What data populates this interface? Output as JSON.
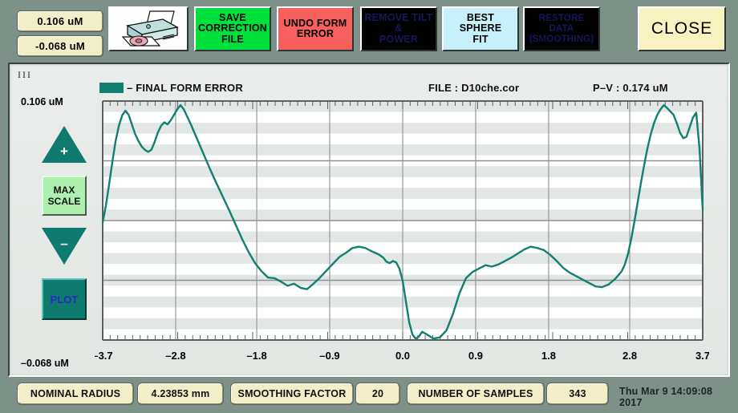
{
  "toolbar": {
    "readout_max": "0.106 uM",
    "readout_min": "-0.068 uM",
    "print_icon": "printer-icon",
    "save_label": "SAVE\nCORRECTION\nFILE",
    "undo_label": "UNDO FORM\nERROR",
    "remove_label": "REMOVE TILT &\nPOWER",
    "sphere_label": "BEST\nSPHERE\nFIT",
    "restore_label": "RESTORE\nDATA\n(SMOOTHING)",
    "close_label": "CLOSE"
  },
  "panel": {
    "corner_mark": "III",
    "legend_label": "– FINAL FORM ERROR",
    "legend_color": "#127f71",
    "file_info": "FILE :  D10che.cor",
    "pv_info": "P–V :   0.174 uM",
    "y_top": "0.106 uM",
    "y_bottom": "–0.068 uM",
    "ctl_max_scale": "MAX\nSCALE",
    "ctl_plot": "PLOT",
    "ctl_up_sign": "+",
    "ctl_down_sign": "–"
  },
  "status": {
    "nominal_radius_label": "NOMINAL RADIUS",
    "nominal_radius_value": "4.23853 mm",
    "smoothing_label": "SMOOTHING FACTOR",
    "smoothing_value": "20",
    "samples_label": "NUMBER OF SAMPLES",
    "samples_value": "343",
    "timestamp": "Thu Mar  9 14:09:08 2017"
  },
  "chart_data": {
    "type": "line",
    "title": "FINAL FORM ERROR",
    "xlabel": "",
    "ylabel": "uM",
    "xlim": [
      -3.7,
      3.7
    ],
    "ylim": [
      -0.068,
      0.106
    ],
    "grid": true,
    "legend_position": "top-left",
    "xticks": [
      -3.7,
      -2.8,
      -1.8,
      -0.9,
      0.0,
      0.9,
      1.8,
      2.8,
      3.7
    ],
    "xticklabels": [
      "–3.7",
      "–2.8",
      "–1.8",
      "–0.9",
      "0.0",
      "0.9",
      "1.8",
      "2.8",
      "3.7"
    ],
    "yticks": [
      -0.068,
      0.106
    ],
    "yticklabels": [
      "–0.068 uM",
      "0.106 uM"
    ],
    "series": [
      {
        "name": "FINAL FORM ERROR",
        "color": "#127f71",
        "x": [
          -3.7,
          -3.66,
          -3.62,
          -3.58,
          -3.54,
          -3.5,
          -3.46,
          -3.42,
          -3.38,
          -3.34,
          -3.3,
          -3.26,
          -3.22,
          -3.18,
          -3.14,
          -3.1,
          -3.06,
          -3.02,
          -2.98,
          -2.94,
          -2.9,
          -2.86,
          -2.82,
          -2.78,
          -2.74,
          -2.7,
          -2.62,
          -2.54,
          -2.46,
          -2.38,
          -2.3,
          -2.22,
          -2.14,
          -2.06,
          -1.98,
          -1.9,
          -1.82,
          -1.74,
          -1.66,
          -1.58,
          -1.5,
          -1.42,
          -1.34,
          -1.26,
          -1.18,
          -1.1,
          -1.02,
          -0.94,
          -0.86,
          -0.78,
          -0.7,
          -0.62,
          -0.54,
          -0.46,
          -0.38,
          -0.3,
          -0.24,
          -0.2,
          -0.16,
          -0.12,
          -0.08,
          -0.04,
          0.0,
          0.04,
          0.08,
          0.12,
          0.16,
          0.2,
          0.24,
          0.3,
          0.38,
          0.46,
          0.54,
          0.62,
          0.7,
          0.78,
          0.86,
          0.94,
          1.02,
          1.1,
          1.18,
          1.26,
          1.34,
          1.42,
          1.5,
          1.58,
          1.66,
          1.74,
          1.82,
          1.9,
          1.98,
          2.06,
          2.14,
          2.22,
          2.3,
          2.38,
          2.46,
          2.54,
          2.62,
          2.7,
          2.74,
          2.78,
          2.82,
          2.86,
          2.9,
          2.94,
          2.98,
          3.02,
          3.06,
          3.1,
          3.14,
          3.18,
          3.22,
          3.26,
          3.3,
          3.34,
          3.38,
          3.42,
          3.46,
          3.5,
          3.54,
          3.58,
          3.62,
          3.66,
          3.7
        ],
        "y": [
          0.0175,
          0.03,
          0.0455,
          0.062,
          0.077,
          0.088,
          0.0955,
          0.099,
          0.096,
          0.089,
          0.082,
          0.077,
          0.073,
          0.0705,
          0.069,
          0.0705,
          0.076,
          0.083,
          0.088,
          0.0905,
          0.089,
          0.092,
          0.096,
          0.1,
          0.103,
          0.1,
          0.09,
          0.079,
          0.068,
          0.057,
          0.0465,
          0.0365,
          0.0265,
          0.016,
          0.0055,
          -0.004,
          -0.012,
          -0.018,
          -0.0225,
          -0.023,
          -0.0255,
          -0.0285,
          -0.027,
          -0.03,
          -0.031,
          -0.027,
          -0.0225,
          -0.0175,
          -0.0125,
          -0.0075,
          -0.0045,
          -0.001,
          0.0,
          -0.001,
          -0.0035,
          -0.0055,
          -0.008,
          -0.011,
          -0.012,
          -0.0105,
          -0.0115,
          -0.016,
          -0.025,
          -0.04,
          -0.055,
          -0.064,
          -0.067,
          -0.0655,
          -0.062,
          -0.064,
          -0.067,
          -0.066,
          -0.061,
          -0.049,
          -0.034,
          -0.023,
          -0.0185,
          -0.016,
          -0.0135,
          -0.0145,
          -0.013,
          -0.0105,
          -0.008,
          -0.005,
          -0.002,
          0.0,
          -0.001,
          -0.0025,
          -0.006,
          -0.0105,
          -0.0155,
          -0.019,
          -0.0215,
          -0.024,
          -0.0265,
          -0.029,
          -0.0295,
          -0.0275,
          -0.0235,
          -0.018,
          -0.013,
          -0.005,
          0.006,
          0.019,
          0.033,
          0.047,
          0.06,
          0.072,
          0.082,
          0.09,
          0.096,
          0.1,
          0.103,
          0.101,
          0.0985,
          0.096,
          0.09,
          0.083,
          0.079,
          0.08,
          0.087,
          0.094,
          0.0975,
          0.072,
          0.027
        ]
      }
    ]
  }
}
